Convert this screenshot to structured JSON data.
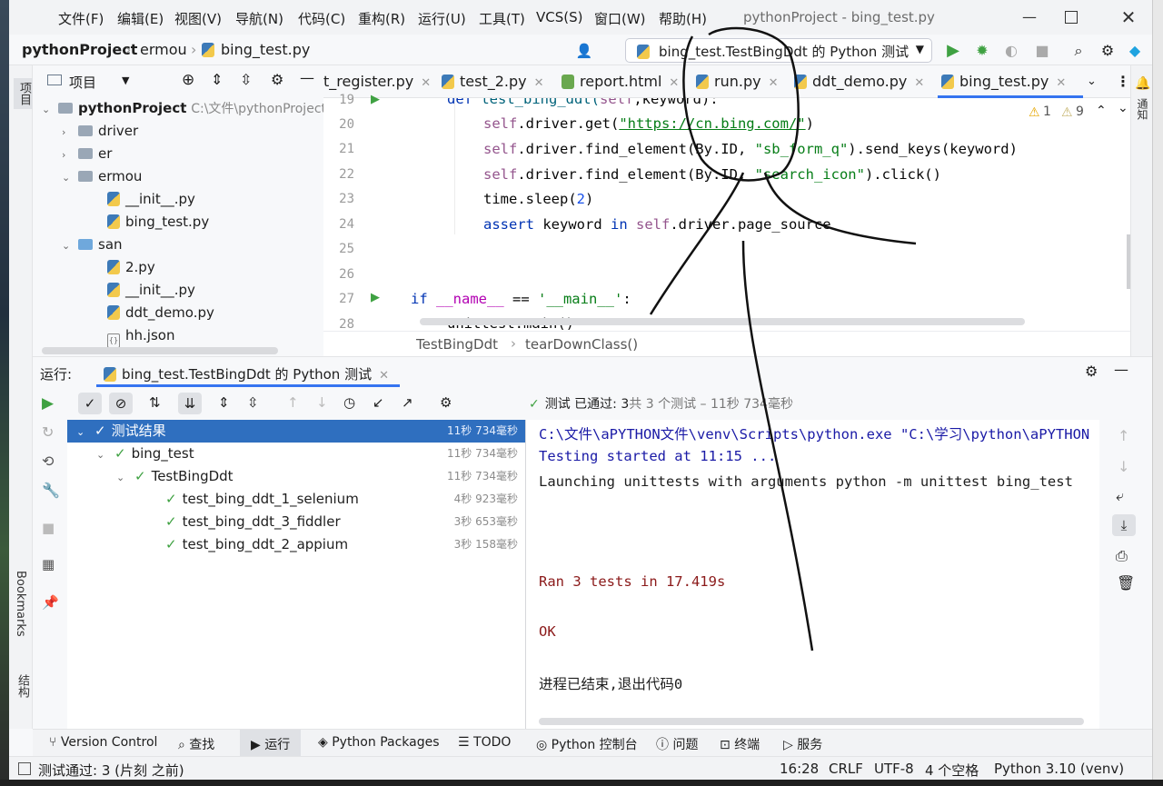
{
  "window": {
    "title": "pythonProject - bing_test.py",
    "menu": [
      "文件(F)",
      "编辑(E)",
      "视图(V)",
      "导航(N)",
      "代码(C)",
      "重构(R)",
      "运行(U)",
      "工具(T)",
      "VCS(S)",
      "窗口(W)",
      "帮助(H)"
    ]
  },
  "navbar": {
    "project": "pythonProject",
    "folder": "ermou",
    "file": "bing_test.py",
    "run_config": "bing_test.TestBingDdt 的 Python 测试"
  },
  "left_strip": {
    "project_label": "项目",
    "bookmarks_label": "Bookmarks",
    "structure_label": "结构"
  },
  "project_panel": {
    "title": "项目",
    "root": "pythonProject",
    "root_path": "C:\\文件\\pythonProject",
    "items": [
      {
        "label": "driver"
      },
      {
        "label": "er"
      },
      {
        "label": "ermou"
      },
      {
        "label": "__init__.py"
      },
      {
        "label": "bing_test.py"
      },
      {
        "label": "san"
      },
      {
        "label": "2.py"
      },
      {
        "label": "__init__.py"
      },
      {
        "label": "ddt_demo.py"
      },
      {
        "label": "hh.json"
      }
    ]
  },
  "editor": {
    "tabs": [
      "t_register.py",
      "test_2.py",
      "report.html",
      "run.py",
      "ddt_demo.py",
      "bing_test.py"
    ],
    "warnings": "1",
    "weak_warnings": "9",
    "line_numbers": [
      "19",
      "20",
      "21",
      "22",
      "23",
      "24",
      "25",
      "26",
      "27",
      "28"
    ],
    "code": {
      "l19_def": "def ",
      "l19_name": "test_bing_ddt(",
      "l19_self": "self",
      "l19_rest": ",keyword):",
      "l20_a": "self",
      "l20_b": ".driver.get(",
      "l20_c": "\"https://cn.bing.com/\"",
      "l20_d": ")",
      "l21_a": "self",
      "l21_b": ".driver.find_element(By.ID, ",
      "l21_c": "\"sb_form_q\"",
      "l21_d": ").send_keys(keyword)",
      "l22_a": "self",
      "l22_b": ".driver.find_element(By.ID, ",
      "l22_c": "\"search_icon\"",
      "l22_d": ").click()",
      "l23_a": "time.sleep(",
      "l23_b": "2",
      "l23_c": ")",
      "l24_a": "assert ",
      "l24_b": "keyword ",
      "l24_c": "in ",
      "l24_d": "self",
      "l24_e": ".driver.page_source",
      "l27_a": "if ",
      "l27_b": "__name__",
      "l27_c": " == ",
      "l27_d": "'__main__'",
      "l27_e": ":",
      "l28": "unittest.main()"
    },
    "breadcrumb_class": "TestBingDdt",
    "breadcrumb_method": "tearDownClass()"
  },
  "run_panel": {
    "label": "运行:",
    "tab": "bing_test.TestBingDdt 的 Python 测试",
    "status_prefix": "测试 已通过: 3",
    "status_suffix": "共 3 个测试 – 11秒 734毫秒",
    "tree": [
      {
        "label": "测试结果",
        "time": "11秒 734毫秒"
      },
      {
        "label": "bing_test",
        "time": "11秒 734毫秒"
      },
      {
        "label": "TestBingDdt",
        "time": "11秒 734毫秒"
      },
      {
        "label": "test_bing_ddt_1_selenium",
        "time": "4秒 923毫秒"
      },
      {
        "label": "test_bing_ddt_3_fiddler",
        "time": "3秒 653毫秒"
      },
      {
        "label": "test_bing_ddt_2_appium",
        "time": "3秒 158毫秒"
      }
    ],
    "console": [
      "C:\\文件\\aPYTHON文件\\venv\\Scripts\\python.exe \"C:\\学习\\python\\aPYTHON",
      "Testing started at 11:15 ...",
      "Launching unittests with arguments python -m unittest bing_test",
      "Ran 3 tests in 17.419s",
      "OK",
      "进程已结束,退出代码0"
    ]
  },
  "tool_tabs": [
    "Version Control",
    "查找",
    "运行",
    "Python Packages",
    "TODO",
    "Python 控制台",
    "问题",
    "终端",
    "服务"
  ],
  "status_bar": {
    "message": "测试通过: 3 (片刻 之前)",
    "position": "16:28",
    "line_sep": "CRLF",
    "encoding": "UTF-8",
    "indent": "4 个空格",
    "interpreter": "Python 3.10 (venv)"
  },
  "colors": {
    "accent": "#3574f0",
    "selected_row": "#2f6fbf",
    "pass_green": "#3fa142",
    "console_blue": "#1a1aa6",
    "console_red": "#8b1a1a"
  }
}
